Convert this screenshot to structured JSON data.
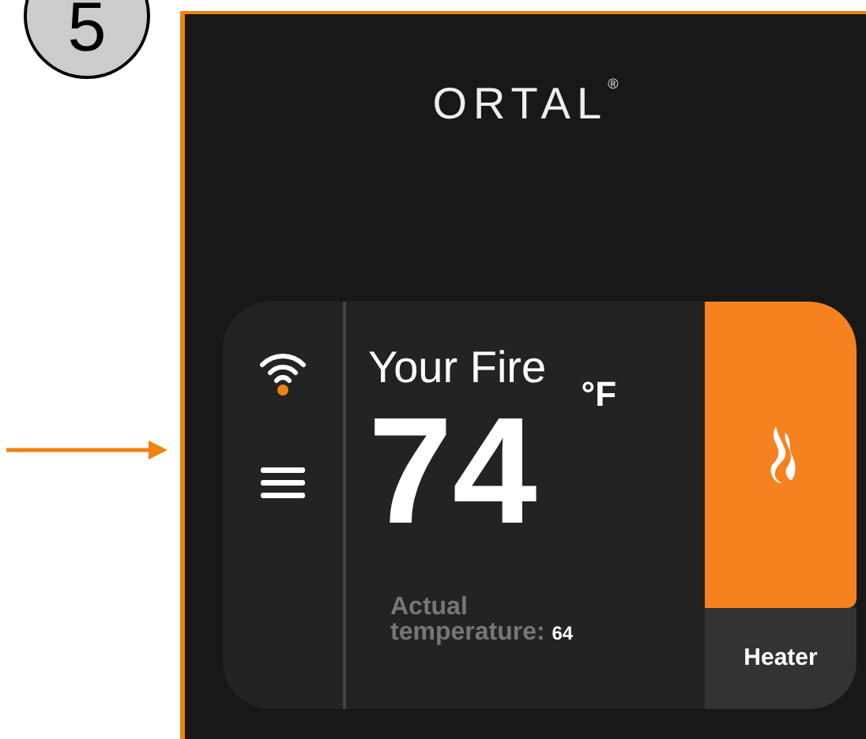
{
  "step": {
    "number": "5"
  },
  "logo": {
    "text": "ORTAL",
    "mark": "®"
  },
  "thermostat": {
    "title": "Your Fire",
    "temperature": "74",
    "unit": "°F",
    "actual_label": "Actual temperature:",
    "actual_value": "64",
    "mode_label": "Heater"
  }
}
